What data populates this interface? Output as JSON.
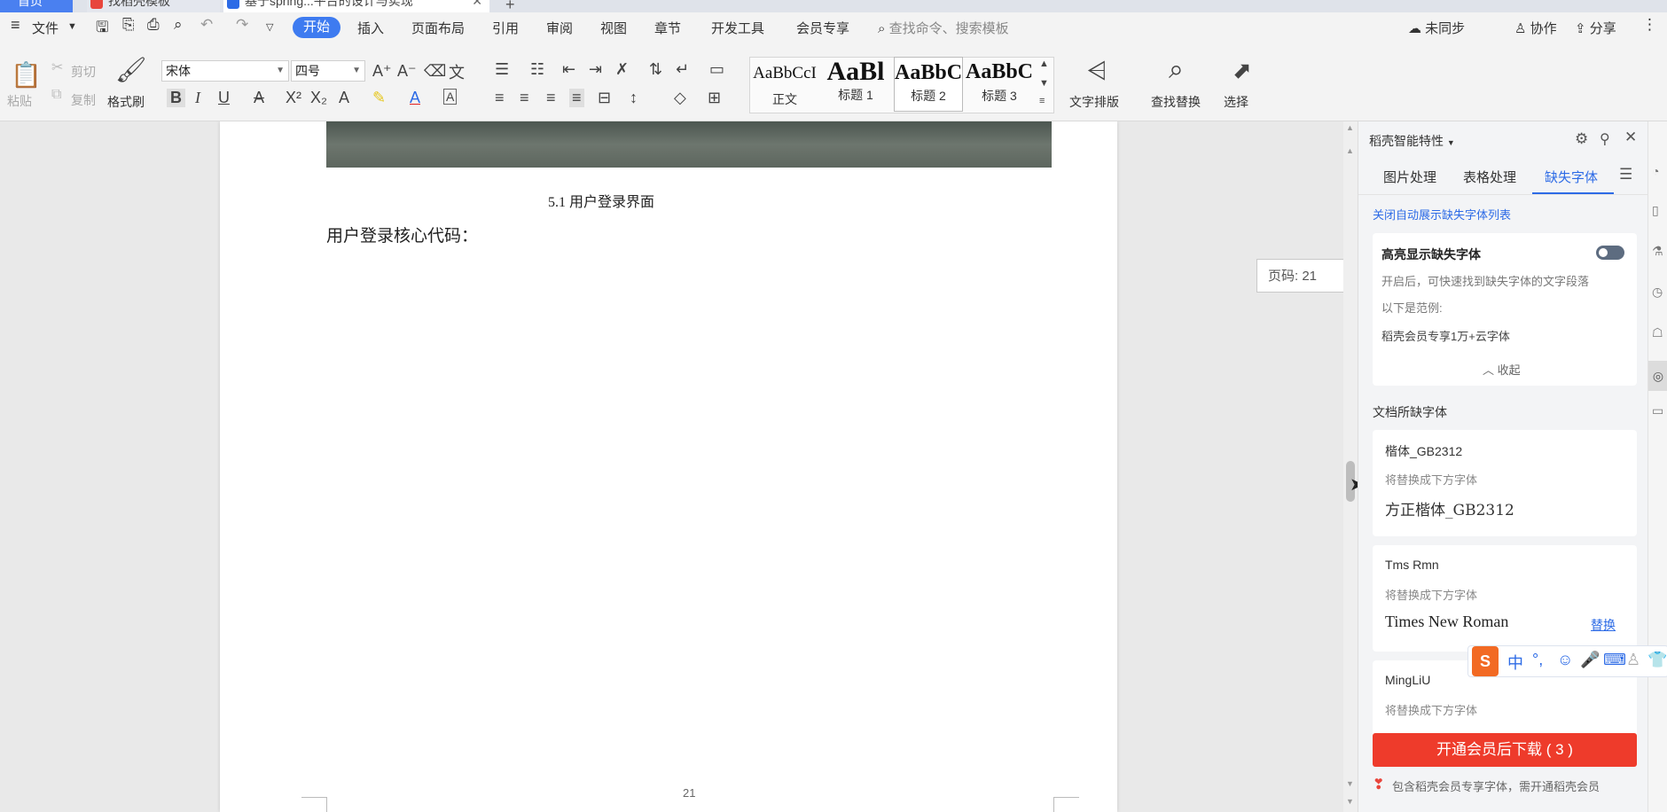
{
  "titlebar": {
    "tabs": [
      {
        "label": "首页"
      },
      {
        "label": "找稻壳模板"
      },
      {
        "label": "基于spring...平台的设计与实现"
      }
    ],
    "new_tab": "+"
  },
  "menubar": {
    "file": "文件",
    "tabs": [
      "开始",
      "插入",
      "页面布局",
      "引用",
      "审阅",
      "视图",
      "章节",
      "开发工具",
      "会员专享"
    ],
    "search_placeholder": "查找命令、搜索模板",
    "sync": "未同步",
    "collab": "协作",
    "share": "分享"
  },
  "ribbon": {
    "paste": "粘贴",
    "cut": "剪切",
    "copy": "复制",
    "format_painter": "格式刷",
    "font_name": "宋体",
    "font_size": "四号",
    "styles": [
      {
        "sample": "AaBbCcI",
        "name": "正文"
      },
      {
        "sample": "AaBl",
        "name": "标题 1"
      },
      {
        "sample": "AaBbC",
        "name": "标题 2"
      },
      {
        "sample": "AaBbC",
        "name": "标题 3"
      }
    ],
    "text_layout": "文字排版",
    "find_replace": "查找替换",
    "select": "选择"
  },
  "document": {
    "caption": "5.1  用户登录界面",
    "body": "用户登录核心代码：",
    "page_number": "21",
    "page_badge": "页码: 21"
  },
  "panel": {
    "title": "稻壳智能特性",
    "tabs": [
      "图片处理",
      "表格处理",
      "缺失字体"
    ],
    "active_tab": "缺失字体",
    "close_link": "关闭自动展示缺失字体列表",
    "highlight": {
      "title": "高亮显示缺失字体",
      "desc": "开启后，可快速找到缺失字体的文字段落",
      "example": "以下是范例:",
      "member": "稻壳会员专享1万+云字体",
      "collapse": "收起"
    },
    "missing_title": "文档所缺字体",
    "fonts": [
      {
        "name": "楷体_GB2312",
        "hint": "将替换成下方字体",
        "replacement": "方正楷体_GB2312",
        "action": ""
      },
      {
        "name": "Tms Rmn",
        "hint": "将替换成下方字体",
        "replacement": "Times New Roman",
        "action": "替换"
      },
      {
        "name": "MingLiU",
        "hint": "将替换成下方字体",
        "replacement": "",
        "action": ""
      }
    ],
    "download_btn": "开通会员后下载 ( 3 )",
    "footer_note": "包含稻壳会员专享字体，需开通稻壳会员"
  },
  "colors": {
    "accent": "#3e7bf0",
    "panel_tab_active": "#2d6be6",
    "download_btn": "#ee3b2b"
  }
}
